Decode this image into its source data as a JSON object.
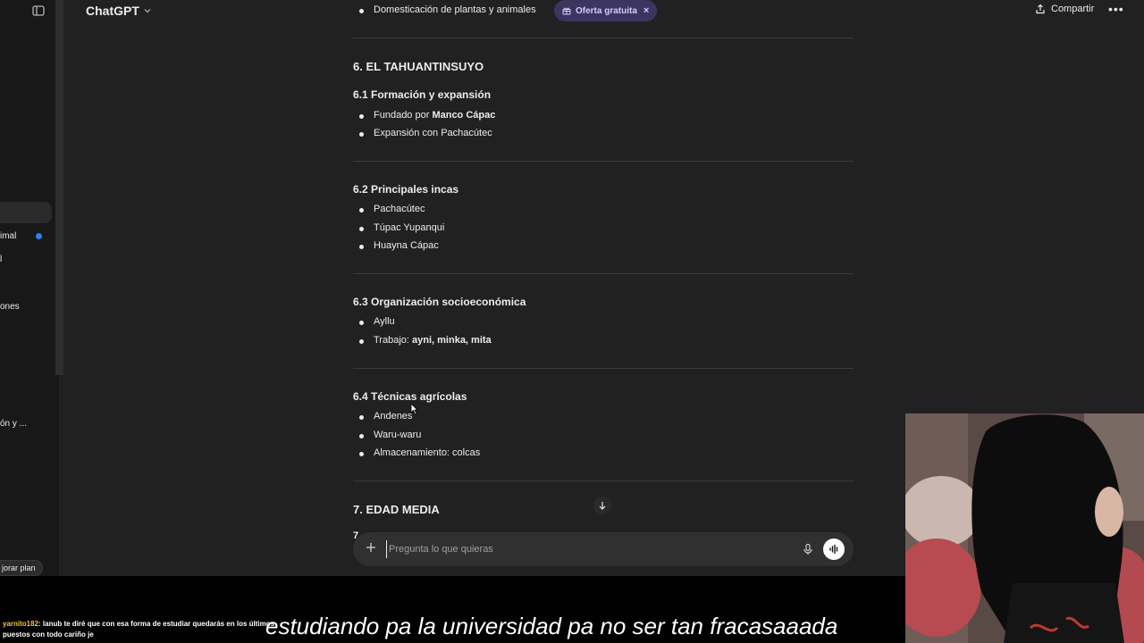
{
  "header": {
    "title": "ChatGPT",
    "share_label": "Compartir",
    "more_label": "•••"
  },
  "sidebar": {
    "items": [
      {
        "label": "imal"
      },
      {
        "label": "l"
      },
      {
        "label": "ones"
      },
      {
        "label": "ón y ..."
      }
    ],
    "plan_label": "jorar plan"
  },
  "content": {
    "top_item": "Domesticación de plantas y animales",
    "offer_badge": "Oferta gratuita",
    "sections": [
      {
        "heading": "6. EL TAHUANTINSUYO",
        "sub": "6.1 Formación y expansión",
        "items": [
          {
            "pre": "Fundado por ",
            "bold": "Manco Cápac"
          },
          {
            "pre": "Expansión con Pachacútec",
            "bold": ""
          }
        ]
      },
      {
        "sub": "6.2 Principales incas",
        "items": [
          "Pachacútec",
          "Túpac Yupanqui",
          "Huayna Cápac"
        ]
      },
      {
        "sub": "6.3 Organización socioeconómica",
        "items": [
          {
            "pre": "Ayllu",
            "bold": ""
          },
          {
            "pre": "Trabajo: ",
            "bold": "ayni, minka, mita"
          }
        ]
      },
      {
        "sub": "6.4 Técnicas agrícolas",
        "items": [
          "Andenes",
          "Waru-waru",
          "Almacenamiento: colcas"
        ]
      }
    ],
    "next_heading": "7. EDAD MEDIA",
    "partial_text": "7."
  },
  "composer": {
    "placeholder": "Pregunta lo que quieras"
  },
  "overlay": {
    "chat_user": "yarnito182",
    "chat_message": ": lanub te diré que con esa forma de estudiar quedarás en los últimos puestos con todo cariño je",
    "subtitle": "estudiando pa la universidad pa no ser tan fracasaaada"
  },
  "colors": {
    "background": "#212121",
    "sidebar": "#181818",
    "offer_bg": "#3b3560",
    "offer_fg": "#d3ccff",
    "accent_dot": "#2f7df6"
  }
}
